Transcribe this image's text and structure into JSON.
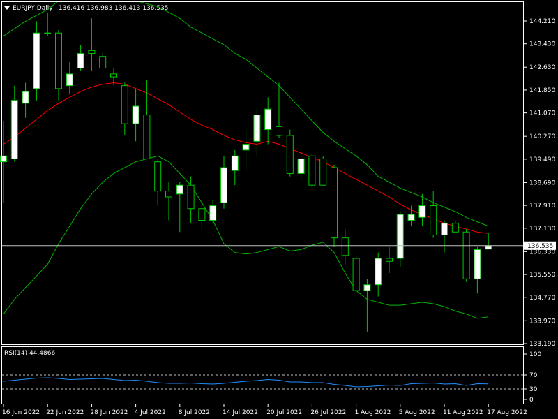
{
  "header": {
    "symbol_label": "EURJPY,Daily",
    "quote": "136.416 136.983 136.413 136.535"
  },
  "price_tag": "136.535",
  "colors": {
    "background": "#000000",
    "frame": "#ffffff",
    "bull_candle": "#ffffff",
    "bear_candle": "#000000",
    "wick": "#00c800",
    "ma": "#ff0000",
    "bollinger": "#00b400",
    "rsi_line": "#1e90ff",
    "level_line": "#bfbfbf"
  },
  "chart_data": [
    {
      "type": "candlestick",
      "name": "EURJPY,Daily",
      "yticks": [
        "144.210",
        "143.430",
        "142.630",
        "141.850",
        "141.070",
        "140.270",
        "139.490",
        "138.690",
        "137.910",
        "137.130",
        "136.330",
        "135.550",
        "134.770",
        "133.970",
        "133.190"
      ],
      "ylim": [
        133.19,
        144.6
      ],
      "xticks": [
        "16 Jun 2022",
        "22 Jun 2022",
        "28 Jun 2022",
        "4 Jul 2022",
        "8 Jul 2022",
        "14 Jul 2022",
        "20 Jul 2022",
        "26 Jul 2022",
        "1 Aug 2022",
        "5 Aug 2022",
        "11 Aug 2022",
        "17 Aug 2022"
      ],
      "xtick_bar_index": [
        0,
        4,
        8,
        12,
        16,
        20,
        24,
        28,
        32,
        36,
        40,
        44
      ],
      "last_price": 136.535,
      "candles": [
        {
          "o": 139.4,
          "h": 140.8,
          "l": 138.0,
          "c": 139.6
        },
        {
          "o": 139.5,
          "h": 142.0,
          "l": 139.4,
          "c": 141.5
        },
        {
          "o": 141.4,
          "h": 142.1,
          "l": 140.9,
          "c": 141.8
        },
        {
          "o": 141.9,
          "h": 144.2,
          "l": 141.5,
          "c": 143.8
        },
        {
          "o": 143.8,
          "h": 144.5,
          "l": 143.7,
          "c": 143.8
        },
        {
          "o": 143.8,
          "h": 143.9,
          "l": 141.5,
          "c": 141.9
        },
        {
          "o": 142.0,
          "h": 142.8,
          "l": 141.7,
          "c": 142.4
        },
        {
          "o": 142.6,
          "h": 143.4,
          "l": 142.5,
          "c": 143.1
        },
        {
          "o": 143.2,
          "h": 144.3,
          "l": 142.5,
          "c": 143.1
        },
        {
          "o": 143.0,
          "h": 143.1,
          "l": 142.6,
          "c": 142.6
        },
        {
          "o": 142.4,
          "h": 142.6,
          "l": 142.0,
          "c": 142.3
        },
        {
          "o": 142.0,
          "h": 142.1,
          "l": 140.3,
          "c": 140.7
        },
        {
          "o": 140.7,
          "h": 141.9,
          "l": 140.1,
          "c": 141.3
        },
        {
          "o": 141.0,
          "h": 142.2,
          "l": 139.5,
          "c": 139.5
        },
        {
          "o": 139.4,
          "h": 139.5,
          "l": 137.9,
          "c": 138.4
        },
        {
          "o": 138.4,
          "h": 138.7,
          "l": 137.4,
          "c": 138.2
        },
        {
          "o": 138.3,
          "h": 138.7,
          "l": 137.0,
          "c": 138.6
        },
        {
          "o": 138.6,
          "h": 138.9,
          "l": 137.3,
          "c": 137.8
        },
        {
          "o": 137.8,
          "h": 138.0,
          "l": 137.1,
          "c": 137.4
        },
        {
          "o": 137.4,
          "h": 138.1,
          "l": 137.3,
          "c": 137.9
        },
        {
          "o": 138.0,
          "h": 139.6,
          "l": 137.8,
          "c": 139.2
        },
        {
          "o": 139.1,
          "h": 139.8,
          "l": 138.6,
          "c": 139.6
        },
        {
          "o": 139.8,
          "h": 140.5,
          "l": 139.1,
          "c": 140.0
        },
        {
          "o": 140.1,
          "h": 141.2,
          "l": 139.6,
          "c": 141.0
        },
        {
          "o": 140.5,
          "h": 141.6,
          "l": 140.0,
          "c": 141.2
        },
        {
          "o": 140.6,
          "h": 142.1,
          "l": 140.2,
          "c": 140.3
        },
        {
          "o": 140.3,
          "h": 140.5,
          "l": 138.9,
          "c": 139.0
        },
        {
          "o": 139.0,
          "h": 139.7,
          "l": 138.8,
          "c": 139.5
        },
        {
          "o": 139.6,
          "h": 139.7,
          "l": 138.5,
          "c": 138.6
        },
        {
          "o": 139.5,
          "h": 139.6,
          "l": 138.6,
          "c": 138.6
        },
        {
          "o": 139.2,
          "h": 139.3,
          "l": 136.5,
          "c": 136.8
        },
        {
          "o": 136.8,
          "h": 137.1,
          "l": 135.9,
          "c": 136.2
        },
        {
          "o": 136.1,
          "h": 136.2,
          "l": 135.0,
          "c": 135.0
        },
        {
          "o": 135.0,
          "h": 135.4,
          "l": 133.6,
          "c": 135.2
        },
        {
          "o": 135.2,
          "h": 136.3,
          "l": 134.8,
          "c": 136.1
        },
        {
          "o": 136.1,
          "h": 136.5,
          "l": 135.6,
          "c": 136.0
        },
        {
          "o": 136.1,
          "h": 137.7,
          "l": 135.8,
          "c": 137.6
        },
        {
          "o": 137.4,
          "h": 137.9,
          "l": 137.2,
          "c": 137.6
        },
        {
          "o": 137.5,
          "h": 138.3,
          "l": 137.2,
          "c": 137.9
        },
        {
          "o": 137.9,
          "h": 138.4,
          "l": 136.8,
          "c": 136.9
        },
        {
          "o": 136.9,
          "h": 137.4,
          "l": 136.3,
          "c": 137.3
        },
        {
          "o": 137.3,
          "h": 137.4,
          "l": 137.0,
          "c": 137.0
        },
        {
          "o": 137.0,
          "h": 137.1,
          "l": 135.3,
          "c": 135.4
        },
        {
          "o": 135.4,
          "h": 136.5,
          "l": 134.9,
          "c": 136.4
        },
        {
          "o": 136.416,
          "h": 136.983,
          "l": 136.413,
          "c": 136.535
        }
      ],
      "ma": [
        140.0,
        140.25,
        140.55,
        140.85,
        141.15,
        141.4,
        141.6,
        141.8,
        141.95,
        142.05,
        142.1,
        142.05,
        141.9,
        141.75,
        141.55,
        141.35,
        141.1,
        140.85,
        140.65,
        140.5,
        140.3,
        140.15,
        140.05,
        140.0,
        140.1,
        140.0,
        139.85,
        139.7,
        139.55,
        139.4,
        139.2,
        139.0,
        138.8,
        138.6,
        138.4,
        138.2,
        137.95,
        137.75,
        137.6,
        137.45,
        137.3,
        137.2,
        137.1,
        137.0,
        136.95
      ],
      "bb_upper": [
        143.7,
        143.95,
        144.2,
        144.4,
        144.6,
        144.9,
        145.0,
        145.1,
        145.2,
        145.2,
        145.1,
        145.0,
        144.9,
        144.8,
        144.7,
        144.5,
        144.3,
        144.0,
        143.8,
        143.6,
        143.4,
        143.1,
        142.9,
        142.6,
        142.3,
        142.0,
        141.6,
        141.2,
        140.8,
        140.4,
        140.1,
        139.85,
        139.6,
        139.3,
        138.9,
        138.7,
        138.5,
        138.35,
        138.2,
        138.0,
        137.85,
        137.7,
        137.5,
        137.35,
        137.2
      ],
      "bb_lower": [
        134.2,
        134.7,
        135.1,
        135.5,
        135.9,
        136.6,
        137.2,
        137.8,
        138.3,
        138.7,
        139.0,
        139.2,
        139.4,
        139.5,
        139.6,
        139.4,
        139.0,
        138.6,
        138.0,
        137.4,
        136.6,
        136.3,
        136.25,
        136.3,
        136.4,
        136.5,
        136.35,
        136.4,
        136.55,
        136.65,
        136.3,
        135.6,
        135.0,
        134.7,
        134.6,
        134.5,
        134.5,
        134.55,
        134.6,
        134.55,
        134.45,
        134.3,
        134.2,
        134.05,
        134.1
      ]
    },
    {
      "type": "line",
      "name": "RSI(14) 44.4866",
      "yticks": [
        "100",
        "70",
        "30",
        "0"
      ],
      "ylim": [
        0,
        100
      ],
      "levels": [
        70,
        30
      ],
      "values": [
        52,
        55,
        58,
        61,
        62,
        60,
        57,
        58,
        59,
        60,
        57,
        54,
        55,
        52,
        48,
        46,
        46,
        47,
        45,
        44,
        46,
        49,
        52,
        54,
        57,
        55,
        50,
        50,
        48,
        48,
        43,
        40,
        36,
        37,
        39,
        41,
        40,
        45,
        46,
        47,
        44,
        45,
        40,
        45,
        44.4866
      ]
    }
  ]
}
